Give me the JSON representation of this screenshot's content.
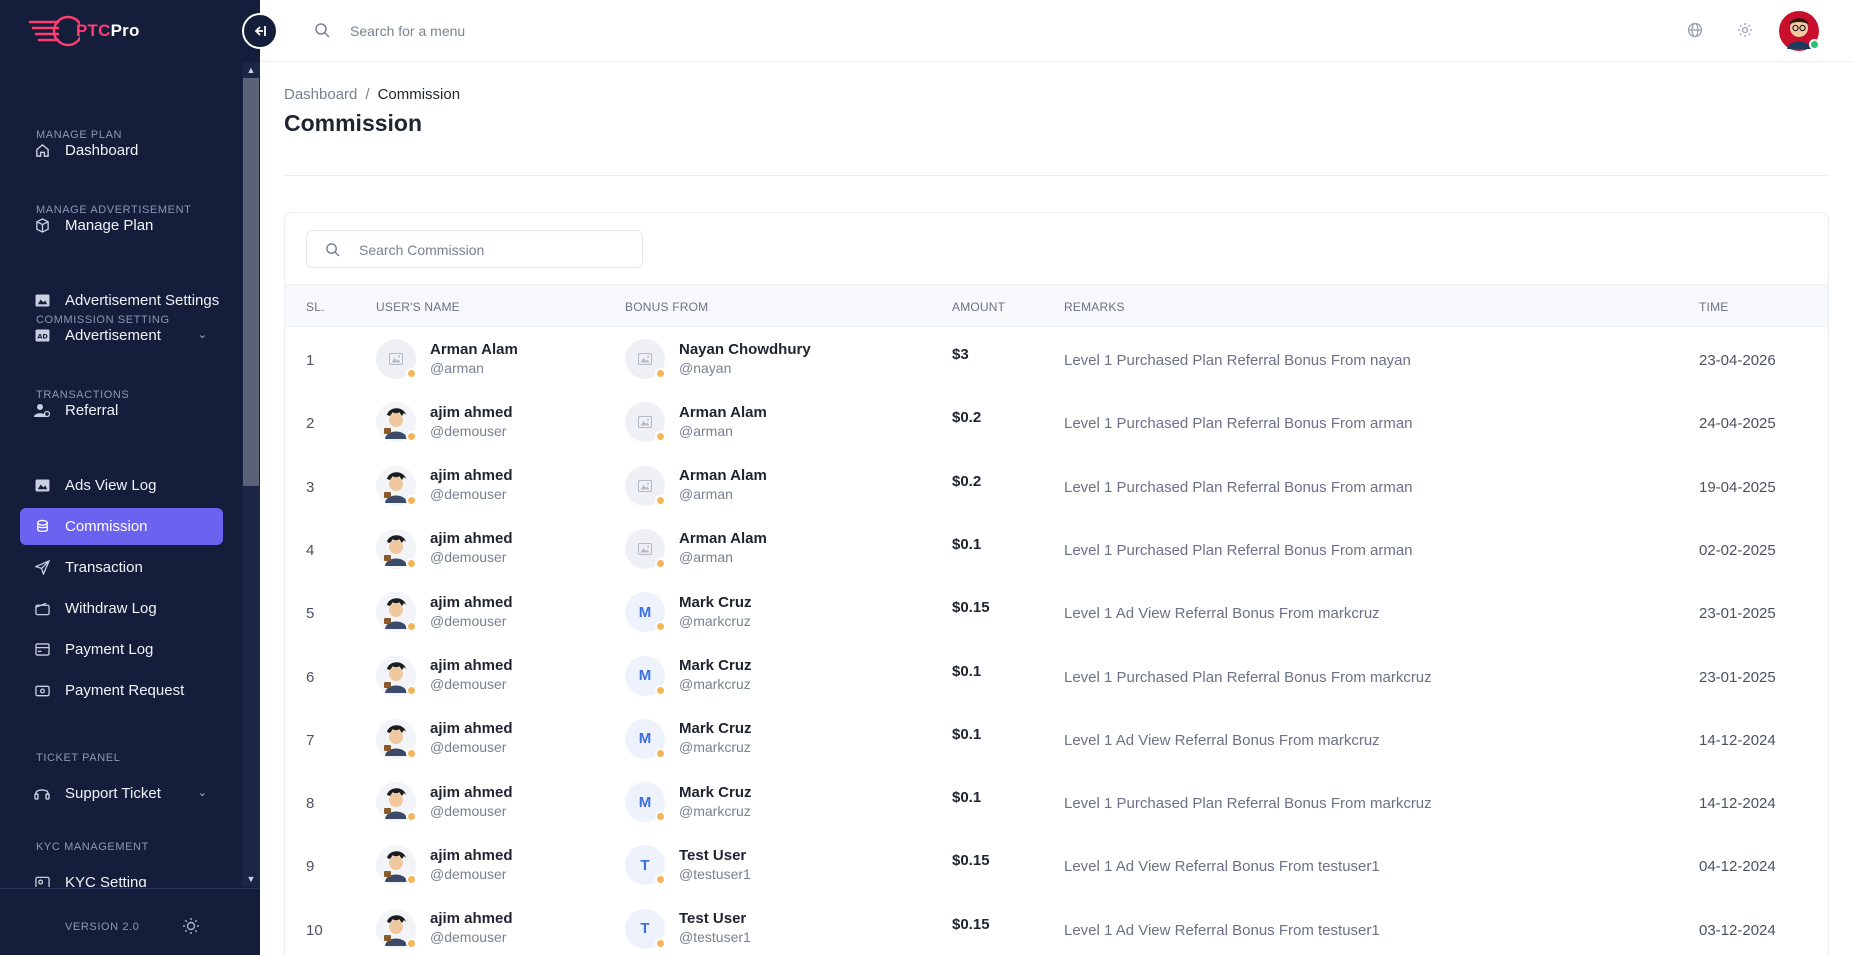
{
  "brand": {
    "ptc": "PTC",
    "pro": "Pro"
  },
  "topbar": {
    "search_placeholder": "Search for a menu"
  },
  "sidebar": {
    "sections": [
      {
        "heading": "MANAGE PLAN"
      },
      {
        "heading": "MANAGE ADVERTISEMENT"
      },
      {
        "heading": "COMMISSION SETTING"
      },
      {
        "heading": "TRANSACTIONS"
      },
      {
        "heading": "TICKET PANEL"
      },
      {
        "heading": "KYC MANAGEMENT"
      }
    ],
    "items": [
      {
        "label": "Dashboard",
        "icon": "home-icon"
      },
      {
        "label": "Manage Plan",
        "icon": "box-icon"
      },
      {
        "label": "Advertisement Settings",
        "icon": "image-icon"
      },
      {
        "label": "Advertisement",
        "icon": "ad-icon"
      },
      {
        "label": "Referral",
        "icon": "user-cog-icon"
      },
      {
        "label": "Ads View Log",
        "icon": "image-icon"
      },
      {
        "label": "Commission",
        "icon": "coins-icon"
      },
      {
        "label": "Transaction",
        "icon": "send-icon"
      },
      {
        "label": "Withdraw Log",
        "icon": "wallet-icon"
      },
      {
        "label": "Payment Log",
        "icon": "card-icon"
      },
      {
        "label": "Payment Request",
        "icon": "cash-icon"
      },
      {
        "label": "Support Ticket",
        "icon": "headset-icon"
      },
      {
        "label": "KYC Setting",
        "icon": "kyc-icon"
      }
    ],
    "version": "VERSION 2.0"
  },
  "breadcrumb": {
    "home": "Dashboard",
    "sep": "/",
    "current": "Commission"
  },
  "page": {
    "title": "Commission"
  },
  "table": {
    "search_placeholder": "Search Commission",
    "headers": [
      "SL.",
      "USER'S NAME",
      "BONUS FROM",
      "AMOUNT",
      "REMARKS",
      "TIME"
    ],
    "rows": [
      {
        "sl": "1",
        "user_name": "Arman Alam",
        "user_handle": "@arman",
        "user_avatar": "placeholder",
        "bonus_name": "Nayan Chowdhury",
        "bonus_handle": "@nayan",
        "bonus_avatar": "placeholder",
        "bonus_letter": "",
        "amount": "$3",
        "remarks": "Level 1 Purchased Plan Referral Bonus From nayan",
        "time": "23-04-2026"
      },
      {
        "sl": "2",
        "user_name": "ajim ahmed",
        "user_handle": "@demouser",
        "user_avatar": "photo",
        "bonus_name": "Arman Alam",
        "bonus_handle": "@arman",
        "bonus_avatar": "placeholder",
        "bonus_letter": "",
        "amount": "$0.2",
        "remarks": "Level 1 Purchased Plan Referral Bonus From arman",
        "time": "24-04-2025"
      },
      {
        "sl": "3",
        "user_name": "ajim ahmed",
        "user_handle": "@demouser",
        "user_avatar": "photo",
        "bonus_name": "Arman Alam",
        "bonus_handle": "@arman",
        "bonus_avatar": "placeholder",
        "bonus_letter": "",
        "amount": "$0.2",
        "remarks": "Level 1 Purchased Plan Referral Bonus From arman",
        "time": "19-04-2025"
      },
      {
        "sl": "4",
        "user_name": "ajim ahmed",
        "user_handle": "@demouser",
        "user_avatar": "photo",
        "bonus_name": "Arman Alam",
        "bonus_handle": "@arman",
        "bonus_avatar": "placeholder",
        "bonus_letter": "",
        "amount": "$0.1",
        "remarks": "Level 1 Purchased Plan Referral Bonus From arman",
        "time": "02-02-2025"
      },
      {
        "sl": "5",
        "user_name": "ajim ahmed",
        "user_handle": "@demouser",
        "user_avatar": "photo",
        "bonus_name": "Mark Cruz",
        "bonus_handle": "@markcruz",
        "bonus_avatar": "letter",
        "bonus_letter": "M",
        "amount": "$0.15",
        "remarks": "Level 1 Ad View Referral Bonus From markcruz",
        "time": "23-01-2025"
      },
      {
        "sl": "6",
        "user_name": "ajim ahmed",
        "user_handle": "@demouser",
        "user_avatar": "photo",
        "bonus_name": "Mark Cruz",
        "bonus_handle": "@markcruz",
        "bonus_avatar": "letter",
        "bonus_letter": "M",
        "amount": "$0.1",
        "remarks": "Level 1 Purchased Plan Referral Bonus From markcruz",
        "time": "23-01-2025"
      },
      {
        "sl": "7",
        "user_name": "ajim ahmed",
        "user_handle": "@demouser",
        "user_avatar": "photo",
        "bonus_name": "Mark Cruz",
        "bonus_handle": "@markcruz",
        "bonus_avatar": "letter",
        "bonus_letter": "M",
        "amount": "$0.1",
        "remarks": "Level 1 Ad View Referral Bonus From markcruz",
        "time": "14-12-2024"
      },
      {
        "sl": "8",
        "user_name": "ajim ahmed",
        "user_handle": "@demouser",
        "user_avatar": "photo",
        "bonus_name": "Mark Cruz",
        "bonus_handle": "@markcruz",
        "bonus_avatar": "letter",
        "bonus_letter": "M",
        "amount": "$0.1",
        "remarks": "Level 1 Purchased Plan Referral Bonus From markcruz",
        "time": "14-12-2024"
      },
      {
        "sl": "9",
        "user_name": "ajim ahmed",
        "user_handle": "@demouser",
        "user_avatar": "photo",
        "bonus_name": "Test User",
        "bonus_handle": "@testuser1",
        "bonus_avatar": "letter",
        "bonus_letter": "T",
        "amount": "$0.15",
        "remarks": "Level 1 Ad View Referral Bonus From testuser1",
        "time": "04-12-2024"
      },
      {
        "sl": "10",
        "user_name": "ajim ahmed",
        "user_handle": "@demouser",
        "user_avatar": "photo",
        "bonus_name": "Test User",
        "bonus_handle": "@testuser1",
        "bonus_avatar": "letter",
        "bonus_letter": "T",
        "amount": "$0.15",
        "remarks": "Level 1 Ad View Referral Bonus From testuser1",
        "time": "03-12-2024"
      }
    ]
  },
  "colors": {
    "sidebar_bg": "#141d3a",
    "accent": "#6b62f0",
    "brand_pink": "#ff3d6e",
    "status_dot": "#f5b45a",
    "online": "#2bc16e"
  }
}
